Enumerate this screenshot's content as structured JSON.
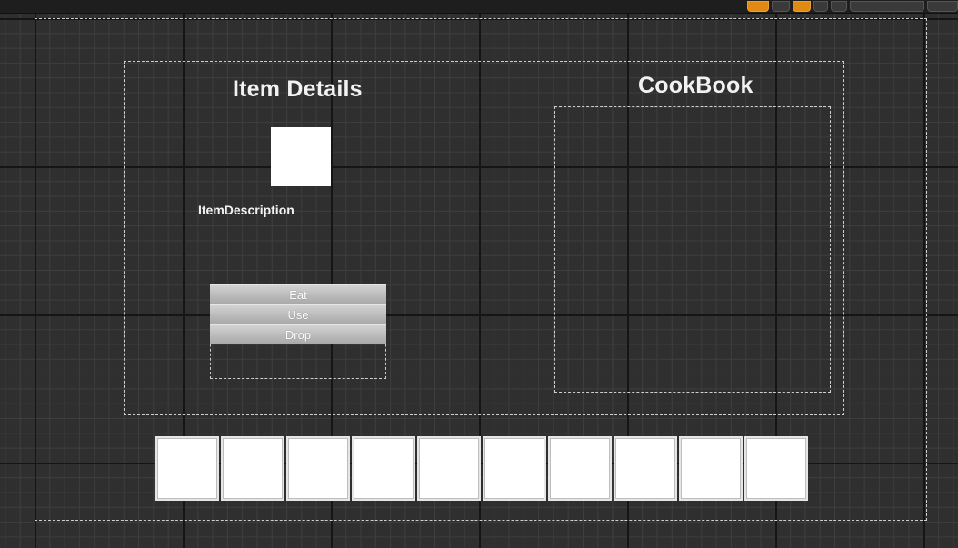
{
  "item_details": {
    "title": "Item Details",
    "description_label": "ItemDescription",
    "actions": [
      {
        "label": "Eat"
      },
      {
        "label": "Use"
      },
      {
        "label": "Drop"
      }
    ]
  },
  "cookbook": {
    "title": "CookBook"
  },
  "inventory": {
    "slot_count": 10
  },
  "colors": {
    "background": "#2f2f2f",
    "button": "#bcbcbc",
    "accent_toolbar": "#e08a14"
  }
}
